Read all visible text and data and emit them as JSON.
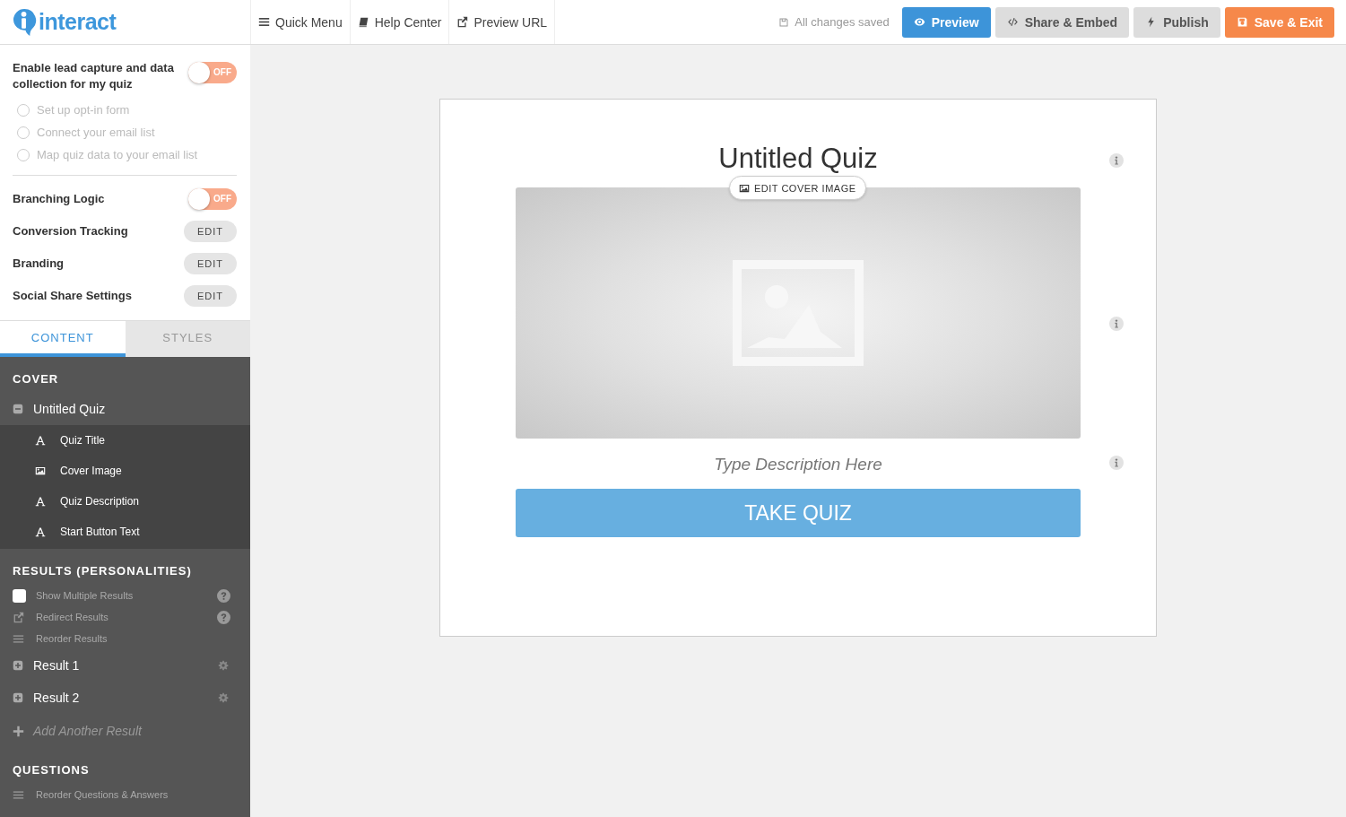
{
  "topbar": {
    "logo": "interact",
    "nav": [
      {
        "label": "Quick Menu"
      },
      {
        "label": "Help Center"
      },
      {
        "label": "Preview URL"
      }
    ],
    "save_status": "All changes saved",
    "actions": [
      {
        "kind": "primary",
        "label": "Preview"
      },
      {
        "kind": "secondary",
        "label": "Share & Embed"
      },
      {
        "kind": "secondary",
        "label": "Publish"
      },
      {
        "kind": "accent",
        "label": "Save & Exit"
      }
    ]
  },
  "settings": {
    "lead_capture": {
      "label": "Enable lead capture and data collection for my quiz",
      "on": false,
      "toggle_text": "OFF",
      "steps": [
        {
          "label": "Set up opt-in form",
          "checked": false
        },
        {
          "label": "Connect your email list",
          "checked": false
        },
        {
          "label": "Map quiz data to your email list",
          "checked": false
        }
      ]
    },
    "rows": [
      {
        "kind": "toggle",
        "label": "Branching Logic",
        "on": false,
        "toggle_text": "OFF"
      },
      {
        "kind": "edit",
        "label": "Conversion Tracking",
        "button": "EDIT"
      },
      {
        "kind": "edit",
        "label": "Branding",
        "button": "EDIT"
      },
      {
        "kind": "edit",
        "label": "Social Share Settings",
        "button": "EDIT"
      }
    ]
  },
  "tabs": [
    {
      "label": "CONTENT",
      "selected": true
    },
    {
      "label": "STYLES",
      "selected": false
    }
  ],
  "outline": {
    "cover": {
      "title": "COVER",
      "group": {
        "label": "Untitled Quiz",
        "expanded": true,
        "items": [
          {
            "label": "Quiz Title"
          },
          {
            "label": "Cover Image"
          },
          {
            "label": "Quiz Description"
          },
          {
            "label": "Start Button Text"
          }
        ]
      }
    },
    "results": {
      "title": "RESULTS (PERSONALITIES)",
      "options": [
        {
          "kind": "checkbox",
          "label": "Show Multiple Results",
          "checked": false,
          "help": true
        },
        {
          "kind": "link",
          "label": "Redirect Results",
          "help": true
        },
        {
          "kind": "reorder",
          "label": "Reorder Results",
          "help": false
        }
      ],
      "items": [
        {
          "label": "Result 1",
          "expanded": false
        },
        {
          "label": "Result 2",
          "expanded": false
        }
      ],
      "add": "Add Another Result"
    },
    "questions": {
      "title": "QUESTIONS",
      "options": [
        {
          "kind": "reorder",
          "label": "Reorder Questions & Answers",
          "help": false
        }
      ]
    }
  },
  "canvas": {
    "title": "Untitled Quiz",
    "cover_button": "EDIT COVER IMAGE",
    "description_placeholder": "Type Description Here",
    "start_button": "TAKE QUIZ"
  }
}
